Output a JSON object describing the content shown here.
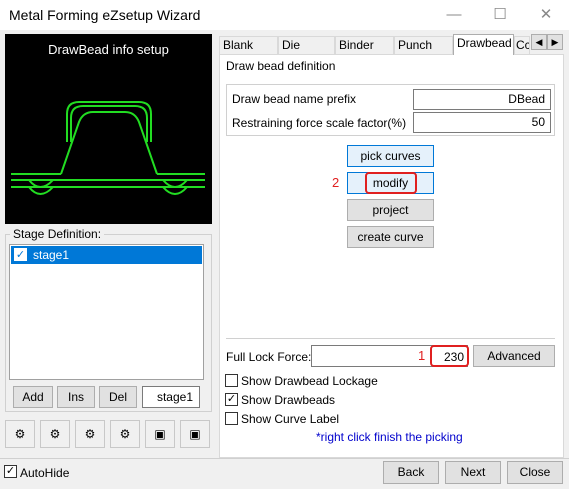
{
  "window": {
    "title": "Metal Forming eZsetup Wizard",
    "minimize": "—",
    "maximize": "☐",
    "close": "✕"
  },
  "preview": {
    "title": "DrawBead info setup"
  },
  "stage": {
    "group_label": "Stage Definition:",
    "items": [
      {
        "label": "stage1",
        "checked": true
      }
    ],
    "add_label": "Add",
    "ins_label": "Ins",
    "del_label": "Del",
    "name_value": "stage1"
  },
  "tabs": [
    "Blank",
    "Die",
    "Binder",
    "Punch",
    "Drawbead",
    "Cc"
  ],
  "active_tab": "Drawbead",
  "drawbead": {
    "group_label": "Draw bead definition",
    "prefix_label": "Draw bead name prefix",
    "prefix_value": "DBead",
    "scale_label": "Restraining force scale factor(%)",
    "scale_value": "50",
    "pick_curves_label": "pick curves",
    "modify_label": "modify",
    "project_label": "project",
    "create_curve_label": "create curve",
    "marker2": "2",
    "marker1": "1",
    "full_lock_label": "Full Lock Force:",
    "full_lock_value": "230",
    "advanced_label": "Advanced",
    "opt_lockage": "Show Drawbead Lockage",
    "opt_drawbeads": "Show Drawbeads",
    "opt_curve_label": "Show Curve Label",
    "opt_lockage_checked": false,
    "opt_drawbeads_checked": true,
    "opt_curve_label_checked": false,
    "hint": "*right click finish the picking"
  },
  "footer": {
    "autohide_label": "AutoHide",
    "autohide_checked": true,
    "back_label": "Back",
    "next_label": "Next",
    "close_label": "Close"
  },
  "colors": {
    "accent": "#0078d7",
    "annotation": "#e02020",
    "curve": "#22dd22",
    "hint": "#0000cc"
  }
}
